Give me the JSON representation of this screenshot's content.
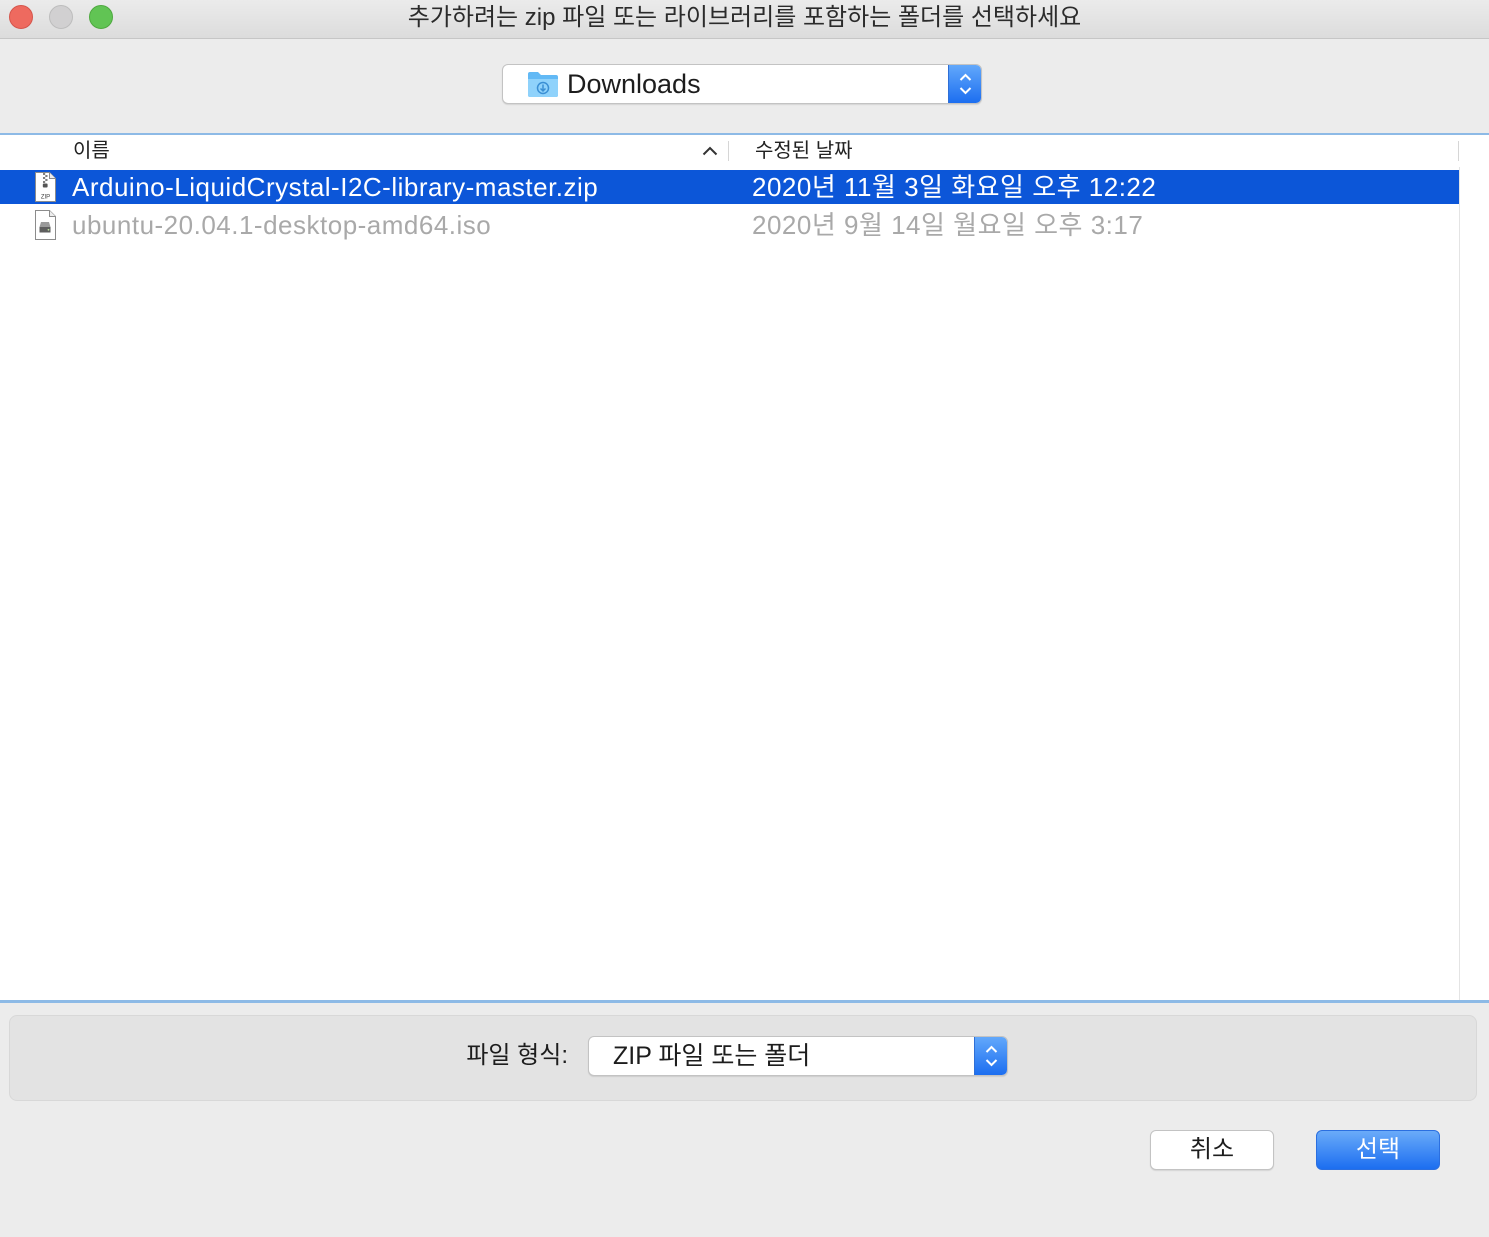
{
  "window": {
    "title": "추가하려는 zip 파일 또는 라이브러리를 포함하는 폴더를 선택하세요"
  },
  "location_popup": {
    "icon": "downloads-folder-icon",
    "selected": "Downloads"
  },
  "file_list": {
    "columns": [
      {
        "label": "이름",
        "sort_icon": "chevron-up-icon"
      },
      {
        "label": "수정된 날짜"
      }
    ],
    "rows": [
      {
        "icon": "zip-file-icon",
        "icon_label": "ZIP",
        "name": "Arduino-LiquidCrystal-I2C-library-master.zip",
        "modified": "2020년 11월 3일 화요일 오후 12:22",
        "selected": true,
        "enabled": true
      },
      {
        "icon": "disk-image-icon",
        "name": "ubuntu-20.04.1-desktop-amd64.iso",
        "modified": "2020년 9월 14일 월요일 오후 3:17",
        "selected": false,
        "enabled": false
      }
    ]
  },
  "file_format": {
    "label": "파일 형식:",
    "selected": "ZIP 파일 또는 폴더"
  },
  "buttons": {
    "cancel": "취소",
    "select": "선택"
  },
  "colors": {
    "selection": "#0c56d8",
    "accent": "#1c6ef0",
    "close_button": "#ee6a5f",
    "minimize_button": "#d1d0d1",
    "zoom_button": "#61c454",
    "disabled_text": "#a9a9a9",
    "divider_blue": "#8dbae6"
  }
}
